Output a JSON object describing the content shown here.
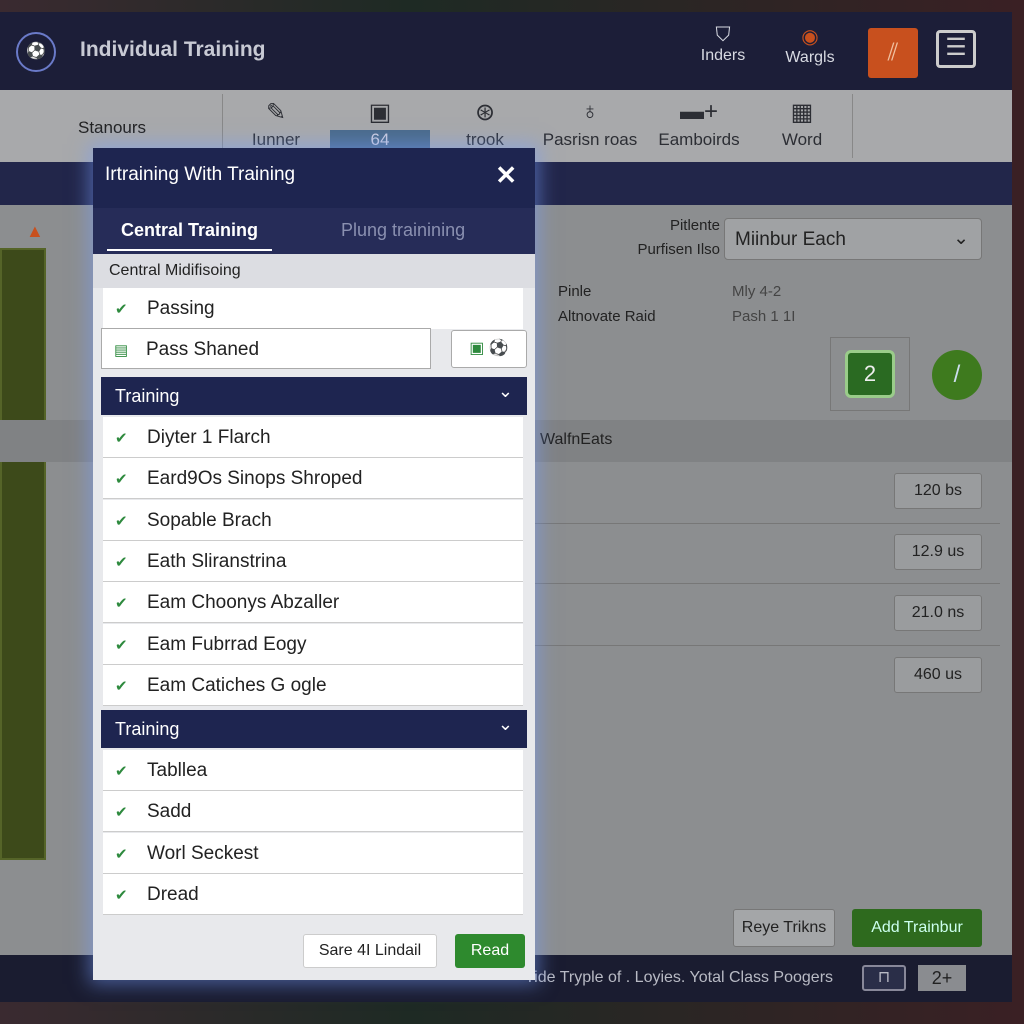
{
  "header": {
    "title": "Individual Training",
    "icons": [
      {
        "label": "Inders",
        "icon": "badge-icon"
      },
      {
        "label": "Wargls",
        "icon": "crest-icon"
      }
    ],
    "accent": "#c8501e"
  },
  "toolbar": {
    "left_label": "Stanours",
    "items": [
      {
        "label": "Iunner",
        "icon": "pencil-icon"
      },
      {
        "label": "64",
        "icon": "board-icon"
      },
      {
        "label": "trook",
        "icon": "whistle-icon"
      },
      {
        "label": "Pasrisn roas",
        "icon": "pin-icon"
      },
      {
        "label": "Eamboirds",
        "icon": "folder-add-icon"
      },
      {
        "label": "Word",
        "icon": "grid-icon"
      }
    ]
  },
  "details": {
    "field1_label": "Pitlente",
    "field2_label": "Purfisen Ilso",
    "select_value": "Miinbur Each",
    "rows": [
      {
        "label": "Pinle",
        "value": "Mly 4-2"
      },
      {
        "label": "Altnovate Raid",
        "value": "Pash 1 1I"
      }
    ],
    "badge": "2",
    "section": "WalfnEats",
    "values": [
      "120 bs",
      "12.9 us",
      "21.0 ns",
      "460 us"
    ]
  },
  "actions": {
    "secondary": "Reye Trikns",
    "primary": "Add Trainbur"
  },
  "footer": {
    "text": "Tide Tryple of . Loyies. Yotal Class Poogers",
    "counter": "2+"
  },
  "modal": {
    "title": "Irtraining With Training",
    "tabs": [
      "Central Training",
      "Plung trainining"
    ],
    "subheader": "Central Midifisoing",
    "top_items": [
      "Passing",
      "Pass Shaned"
    ],
    "sections": [
      {
        "title": "Training",
        "items": [
          "Diyter 1 Flarch",
          "Eard9Os Sinops Shroped",
          "Sopable Brach",
          "Eath Sliranstrina",
          "Eam Choonys Abzaller",
          "Eam Fubrrad Eogy",
          "Eam Catiches G ogle"
        ]
      },
      {
        "title": "Training",
        "items": [
          "Tabllea",
          "Sadd",
          "Worl Seckest",
          "Dread"
        ]
      }
    ],
    "cancel": "Sare 4I Lindail",
    "confirm": "Read"
  },
  "colors": {
    "navy": "#1e2550",
    "green": "#2e7a2a"
  }
}
